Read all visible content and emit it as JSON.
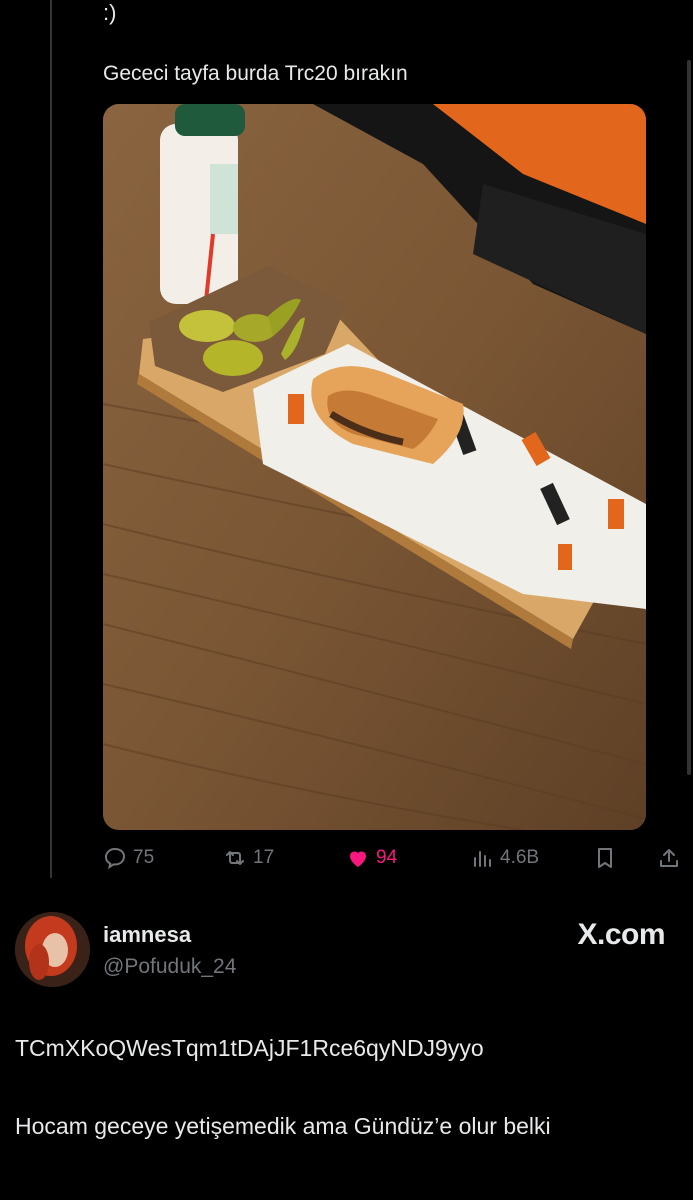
{
  "tweet": {
    "top_text": ":)",
    "text": "Gececi tayfa burda Trc20 bırakın",
    "image_alt": "Kokoreç sandwich with pickles and ayran on wooden table"
  },
  "actions": {
    "replies": "75",
    "retweets": "17",
    "likes": "94",
    "views": "4.6B",
    "icons": [
      "reply-icon",
      "retweet-icon",
      "like-icon",
      "views-icon",
      "bookmark-icon",
      "share-icon"
    ],
    "like_color": "#f91880"
  },
  "reply": {
    "name": "iamnesa",
    "handle": "@Pofuduk_24",
    "brand": "X.com",
    "line1": "TCmXKoQWesTqm1tDAjJF1Rce6qyNDJ9yyo",
    "line2": "Hocam geceye yetişemedik ama Gündüz’e olur belki"
  }
}
